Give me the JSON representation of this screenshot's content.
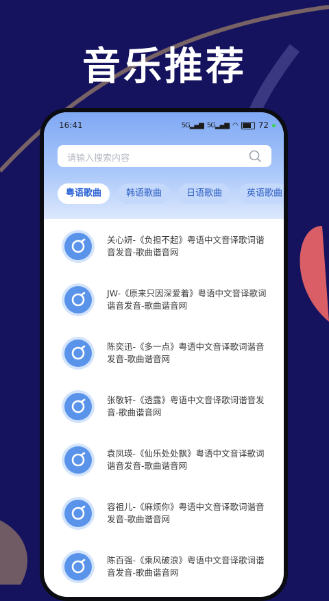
{
  "headline": "音乐推荐",
  "status_bar": {
    "time": "16:41",
    "signal1": "5G",
    "signal2": "5G",
    "battery": "72"
  },
  "search": {
    "placeholder": "请输入搜索内容",
    "icon": "search-icon"
  },
  "tabs": [
    {
      "label": "粤语歌曲",
      "active": true
    },
    {
      "label": "韩语歌曲",
      "active": false
    },
    {
      "label": "日语歌曲",
      "active": false
    },
    {
      "label": "英语歌曲",
      "active": false
    }
  ],
  "songs": [
    {
      "title": "关心妍-《负担不起》粤语中文音译歌词谐音发音-歌曲谐音网",
      "icon": "music-disc-icon"
    },
    {
      "title": "JW-《原来只因深爱着》粤语中文音译歌词谐音发音-歌曲谐音网",
      "icon": "music-disc-icon"
    },
    {
      "title": "陈奕迅-《多一点》粤语中文音译歌词谐音发音-歌曲谐音网",
      "icon": "music-disc-icon"
    },
    {
      "title": "张敬轩-《透露》粤语中文音译歌词谐音发音-歌曲谐音网",
      "icon": "music-disc-icon"
    },
    {
      "title": "袁凤瑛-《仙乐处处飘》粤语中文音译歌词谐音发音-歌曲谐音网",
      "icon": "music-disc-icon"
    },
    {
      "title": "容祖儿-《麻烦你》粤语中文音译歌词谐音发音-歌曲谐音网",
      "icon": "music-disc-icon"
    },
    {
      "title": "陈百强-《乘风破浪》粤语中文音译歌词谐音发音-歌曲谐音网",
      "icon": "music-disc-icon"
    }
  ],
  "colors": {
    "background": "#16135e",
    "accent": "#5a93ea",
    "tab_active_text": "#2b63d6"
  }
}
